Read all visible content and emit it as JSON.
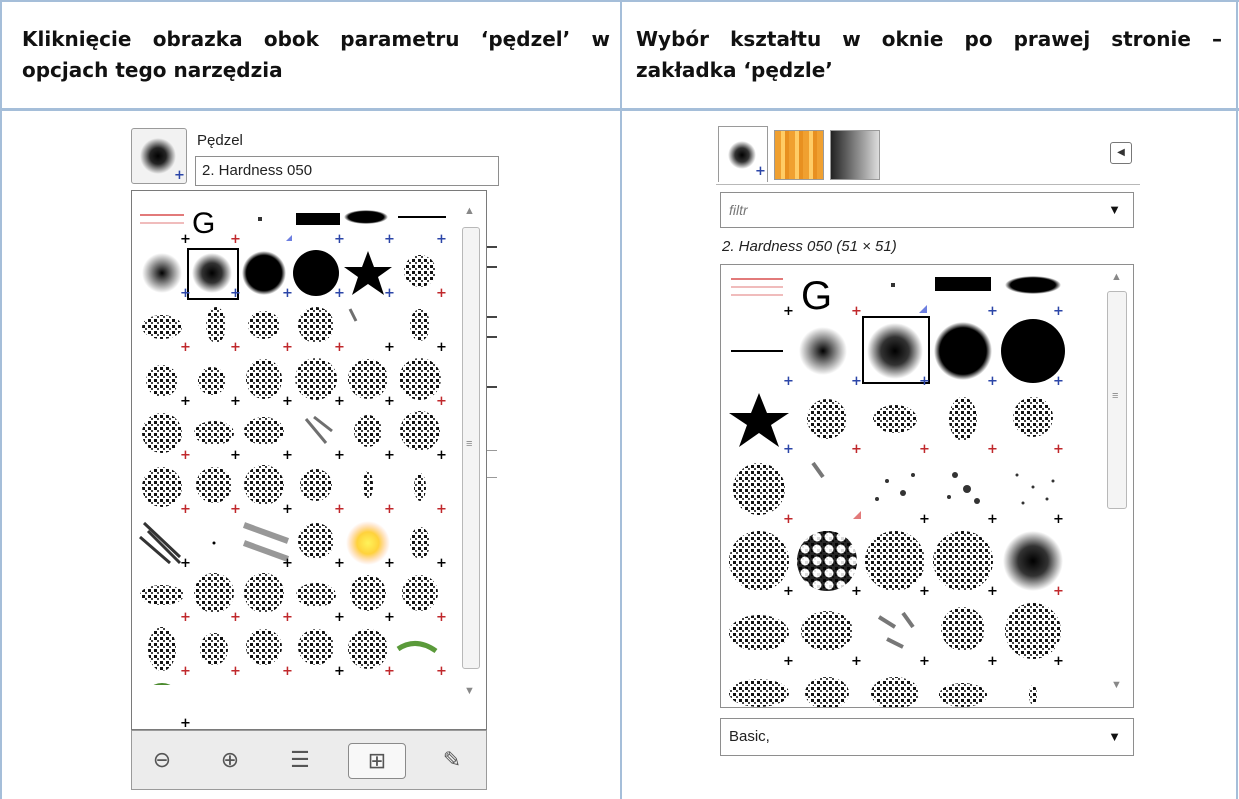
{
  "table": {
    "header_left": "Kliknięcie obrazka obok parametru ‘pędzel’ w opcjach tego narzędzia",
    "header_right": "Wybór kształtu w oknie po prawej stronie – zakładka ‘pędzle’"
  },
  "left_screenshot": {
    "param_label": "Pędzel",
    "brush_value": "2. Hardness 050",
    "toolbar": [
      "zoom-out-icon",
      "zoom-in-icon",
      "list-view-icon",
      "grid-view-icon",
      "edit-brush-icon"
    ],
    "active_view": "grid-view-icon"
  },
  "right_screenshot": {
    "tabs": [
      "brushes-tab",
      "patterns-tab",
      "gradients-tab"
    ],
    "filter_placeholder": "filtr",
    "selected_brush": "2. Hardness 050 (51 × 51)",
    "tag_value": "Basic,"
  },
  "colors": {
    "table_border": "#a5bed9",
    "plus_blue": "#2c46a8",
    "plus_red": "#c0282c"
  }
}
